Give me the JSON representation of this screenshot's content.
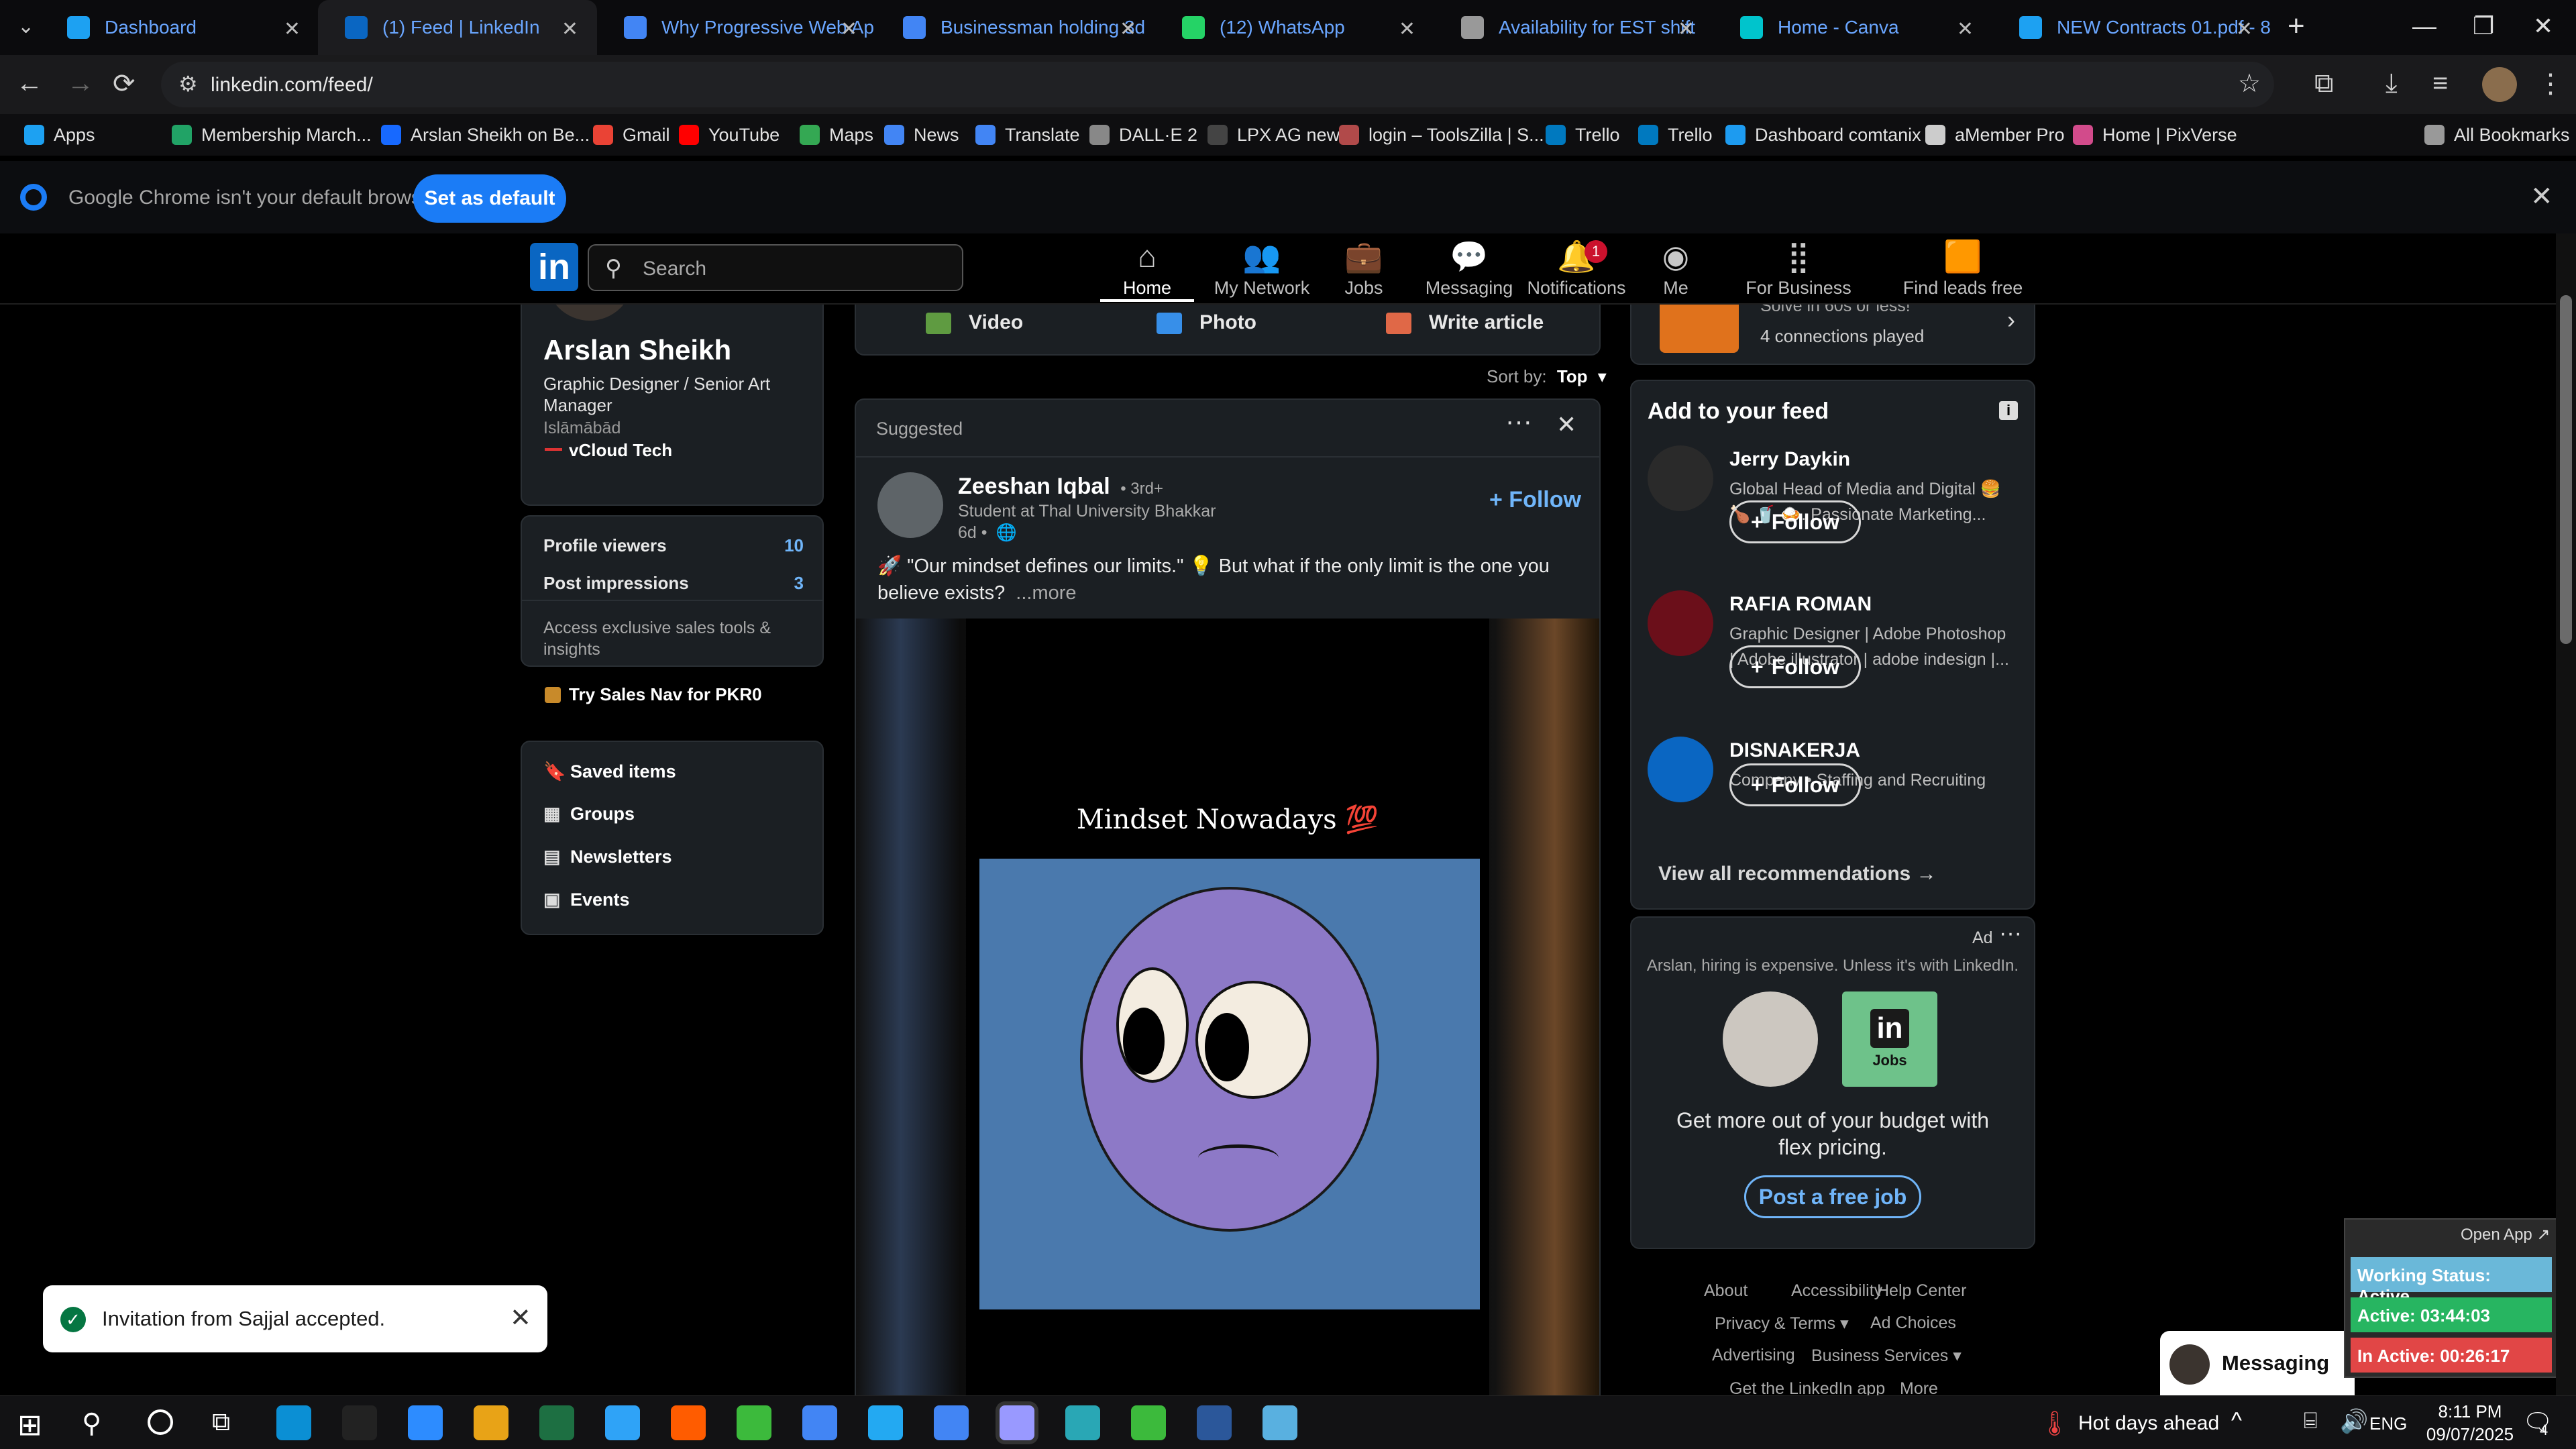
{
  "tabs": [
    {
      "title": "Dashboard",
      "color": "#1da1f2"
    },
    {
      "title": "(1) Feed | LinkedIn",
      "color": "#0a66c2"
    },
    {
      "title": "Why Progressive Web Ap",
      "color": "#4285f4"
    },
    {
      "title": "Businessman holding 3d",
      "color": "#4285f4"
    },
    {
      "title": "(12) WhatsApp",
      "color": "#25d366"
    },
    {
      "title": "Availability for EST shift",
      "color": "#999999"
    },
    {
      "title": "Home - Canva",
      "color": "#00c4cc"
    },
    {
      "title": "NEW Contracts 01.pdf - 8",
      "color": "#1da1f2"
    }
  ],
  "omnibox": {
    "url": "linkedin.com/feed/"
  },
  "bookmarks": [
    {
      "label": "Apps"
    },
    {
      "label": "Membership March..."
    },
    {
      "label": "Arslan Sheikh on Be..."
    },
    {
      "label": "Gmail"
    },
    {
      "label": "YouTube"
    },
    {
      "label": "Maps"
    },
    {
      "label": "News"
    },
    {
      "label": "Translate"
    },
    {
      "label": "DALL·E 2"
    },
    {
      "label": "LPX AG new"
    },
    {
      "label": "login – ToolsZilla | S..."
    },
    {
      "label": "Trello"
    },
    {
      "label": "Trello"
    },
    {
      "label": "Dashboard comtanix"
    },
    {
      "label": "aMember Pro"
    },
    {
      "label": "Home | PixVerse"
    },
    {
      "label": "All Bookmarks"
    }
  ],
  "default_bar": {
    "message": "Google Chrome isn't your default browser",
    "button": "Set as default"
  },
  "li_header": {
    "search_placeholder": "Search",
    "nav": [
      {
        "label": "Home"
      },
      {
        "label": "My Network"
      },
      {
        "label": "Jobs"
      },
      {
        "label": "Messaging"
      },
      {
        "label": "Notifications",
        "badge": "1"
      },
      {
        "label": "Me"
      },
      {
        "label": "For Business"
      },
      {
        "label": "Find leads free"
      }
    ]
  },
  "profile": {
    "name": "Arslan Sheikh",
    "headline": "Graphic Designer / Senior Art Manager",
    "location": "Islāmābād",
    "company": "vCloud Tech",
    "stats": [
      {
        "label": "Profile viewers",
        "value": "10"
      },
      {
        "label": "Post impressions",
        "value": "3"
      }
    ],
    "sales_text": "Access exclusive sales tools & insights",
    "sales_link": "Try Sales Nav for PKR0",
    "links": [
      {
        "label": "Saved items"
      },
      {
        "label": "Groups"
      },
      {
        "label": "Newsletters"
      },
      {
        "label": "Events"
      }
    ]
  },
  "composer": {
    "actions": [
      {
        "label": "Video"
      },
      {
        "label": "Photo"
      },
      {
        "label": "Write article"
      }
    ]
  },
  "sort": {
    "label": "Sort by:",
    "value": "Top"
  },
  "post": {
    "suggested": "Suggested",
    "author": "Zeeshan Iqbal",
    "degree": "• 3rd+",
    "subtitle": "Student at Thal University Bhakkar",
    "time": "6d •",
    "follow": "+ Follow",
    "text": "🚀 \"Our mindset defines our limits.\" 💡 But what if the only limit is the one you believe exists?",
    "more": "...more",
    "image_title": "Mindset Nowadays 💯"
  },
  "feed_right": {
    "game_line": "Solve in 60s or less!",
    "game_sub": "4 connections played",
    "title": "Add to your feed",
    "people": [
      {
        "name": "Jerry Daykin",
        "desc": "Global Head of Media and Digital 🍔 🍗 🥤 🍛. Passionate Marketing...",
        "follow": "Follow"
      },
      {
        "name": "RAFIA ROMAN",
        "desc": "Graphic Designer | Adobe Photoshop | Adobe illustrator | adobe indesign |...",
        "follow": "Follow"
      },
      {
        "name": "DISNAKERJA",
        "desc": "Company • Staffing and Recruiting",
        "follow": "Follow"
      }
    ],
    "view_all": "View all recommendations →"
  },
  "ad": {
    "label": "Ad",
    "line": "Arslan, hiring is expensive. Unless it's with LinkedIn.",
    "jobs_label": "Jobs",
    "headline": "Get more out of your budget with flex pricing.",
    "cta": "Post a free job"
  },
  "footer_links": [
    {
      "label": "About"
    },
    {
      "label": "Accessibility"
    },
    {
      "label": "Help Center"
    },
    {
      "label": "Privacy & Terms ▾"
    },
    {
      "label": "Ad Choices"
    },
    {
      "label": "Advertising"
    },
    {
      "label": "Business Services ▾"
    },
    {
      "label": "Get the LinkedIn app"
    },
    {
      "label": "More"
    }
  ],
  "toast": {
    "message": "Invitation from Sajjal accepted."
  },
  "messaging": {
    "label": "Messaging"
  },
  "tracker": {
    "open_app": "Open App ↗",
    "status": "Working Status: Active",
    "active": "Active: 03:44:03",
    "inactive": "In Active: 00:26:17"
  },
  "taskbar": {
    "weather": "Hot days ahead",
    "lang": "ENG",
    "time": "8:11 PM",
    "date": "09/07/2025",
    "notif_count": "4"
  }
}
